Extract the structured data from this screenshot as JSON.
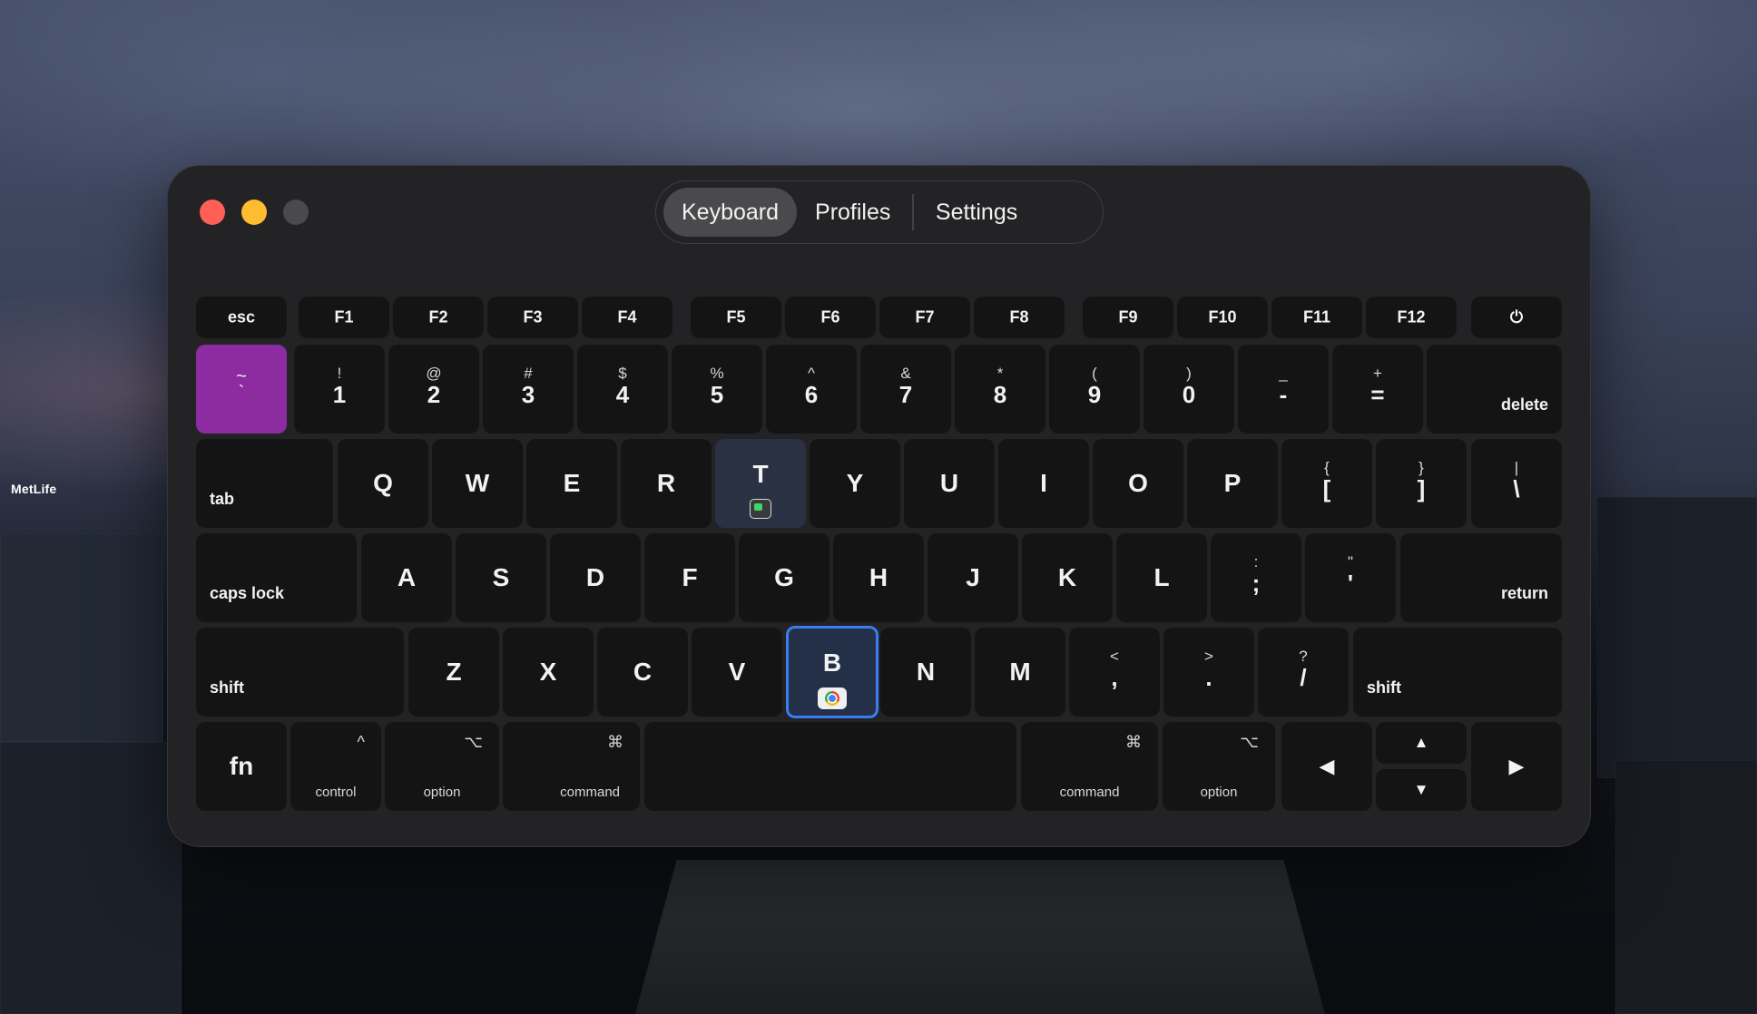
{
  "background": {
    "building_sign": "MetLife"
  },
  "window": {
    "tabs": [
      {
        "label": "Keyboard",
        "active": true
      },
      {
        "label": "Profiles",
        "active": false
      },
      {
        "label": "Settings",
        "active": false
      }
    ]
  },
  "keyboard": {
    "fn_row": [
      "esc",
      "F1",
      "F2",
      "F3",
      "F4",
      "F5",
      "F6",
      "F7",
      "F8",
      "F9",
      "F10",
      "F11",
      "F12",
      "⏻"
    ],
    "number_row": [
      {
        "top": "~",
        "bottom": "`"
      },
      {
        "top": "!",
        "bottom": "1"
      },
      {
        "top": "@",
        "bottom": "2"
      },
      {
        "top": "#",
        "bottom": "3"
      },
      {
        "top": "$",
        "bottom": "4"
      },
      {
        "top": "%",
        "bottom": "5"
      },
      {
        "top": "^",
        "bottom": "6"
      },
      {
        "top": "&",
        "bottom": "7"
      },
      {
        "top": "*",
        "bottom": "8"
      },
      {
        "top": "(",
        "bottom": "9"
      },
      {
        "top": ")",
        "bottom": "0"
      },
      {
        "top": "_",
        "bottom": "-"
      },
      {
        "top": "+",
        "bottom": "="
      }
    ],
    "delete_label": "delete",
    "tab_label": "tab",
    "qwerty_row": [
      "Q",
      "W",
      "E",
      "R",
      "T",
      "Y",
      "U",
      "I",
      "O",
      "P"
    ],
    "bracket_keys": [
      {
        "top": "{",
        "bottom": "["
      },
      {
        "top": "}",
        "bottom": "]"
      },
      {
        "top": "|",
        "bottom": "\\"
      }
    ],
    "caps_label": "caps lock",
    "asdf_row": [
      "A",
      "S",
      "D",
      "F",
      "G",
      "H",
      "J",
      "K",
      "L"
    ],
    "semicolon_keys": [
      {
        "top": ":",
        "bottom": ";"
      },
      {
        "top": "\"",
        "bottom": "'"
      }
    ],
    "return_label": "return",
    "shift_label": "shift",
    "zxcv_row": [
      "Z",
      "X",
      "C",
      "V",
      "B",
      "N",
      "M"
    ],
    "comma_keys": [
      {
        "top": "<",
        "bottom": ","
      },
      {
        "top": ">",
        "bottom": "."
      },
      {
        "top": "?",
        "bottom": "/"
      }
    ],
    "bottom_row": {
      "fn": "fn",
      "control": {
        "glyph": "^",
        "label": "control"
      },
      "option_left": {
        "glyph": "⌥",
        "label": "option"
      },
      "command_left": {
        "glyph": "⌘",
        "label": "command"
      },
      "command_right": {
        "glyph": "⌘",
        "label": "command"
      },
      "option_right": {
        "glyph": "⌥",
        "label": "option"
      },
      "arrows": {
        "left": "◀",
        "up": "▲",
        "down": "▼",
        "right": "▶"
      }
    },
    "assigned_keys": [
      {
        "key": "`",
        "color": "#8c2ca0"
      },
      {
        "key": "T",
        "app_icon": "terminal-app-icon"
      },
      {
        "key": "B",
        "app_icon": "chrome-app-icon",
        "selected": true
      }
    ]
  },
  "colors": {
    "accent_purple": "#8c2ca0",
    "selection_blue": "#3b7cf2",
    "close": "#ff5f57",
    "minimize": "#febc2e"
  }
}
